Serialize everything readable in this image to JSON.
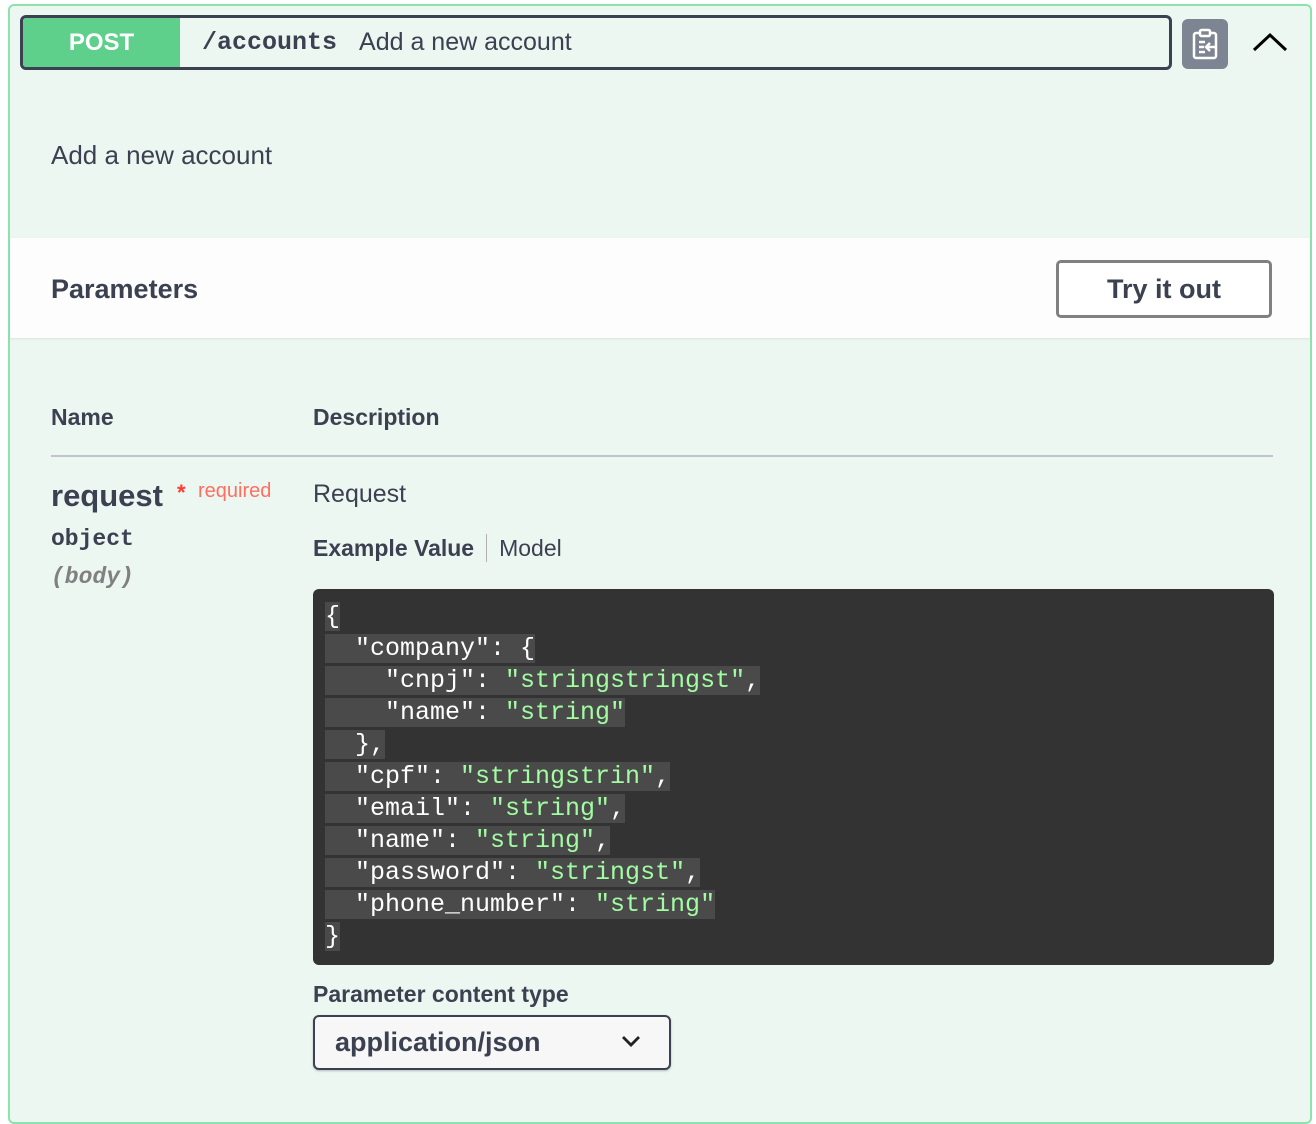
{
  "operation": {
    "method": "POST",
    "path": "/accounts",
    "summary": "Add a new account",
    "description": "Add a new account"
  },
  "parameters_section": {
    "title": "Parameters",
    "try_button": "Try it out",
    "columns": {
      "name": "Name",
      "description": "Description"
    }
  },
  "parameter": {
    "name": "request",
    "required_star": "*",
    "required_label": "required",
    "type": "object",
    "in": "(body)",
    "description": "Request",
    "tabs": {
      "example": "Example Value",
      "model": "Model"
    }
  },
  "example_lines": [
    [
      {
        "t": "{",
        "c": "p"
      }
    ],
    [
      {
        "t": "  \"company\": {",
        "c": "p"
      }
    ],
    [
      {
        "t": "    \"cnpj\": ",
        "c": "p"
      },
      {
        "t": "\"stringstringst\"",
        "c": "s"
      },
      {
        "t": ",",
        "c": "p"
      }
    ],
    [
      {
        "t": "    \"name\": ",
        "c": "p"
      },
      {
        "t": "\"string\"",
        "c": "s"
      }
    ],
    [
      {
        "t": "  },",
        "c": "p"
      }
    ],
    [
      {
        "t": "  \"cpf\": ",
        "c": "p"
      },
      {
        "t": "\"stringstrin\"",
        "c": "s"
      },
      {
        "t": ",",
        "c": "p"
      }
    ],
    [
      {
        "t": "  \"email\": ",
        "c": "p"
      },
      {
        "t": "\"string\"",
        "c": "s"
      },
      {
        "t": ",",
        "c": "p"
      }
    ],
    [
      {
        "t": "  \"name\": ",
        "c": "p"
      },
      {
        "t": "\"string\"",
        "c": "s"
      },
      {
        "t": ",",
        "c": "p"
      }
    ],
    [
      {
        "t": "  \"password\": ",
        "c": "p"
      },
      {
        "t": "\"stringst\"",
        "c": "s"
      },
      {
        "t": ",",
        "c": "p"
      }
    ],
    [
      {
        "t": "  \"phone_number\": ",
        "c": "p"
      },
      {
        "t": "\"string\"",
        "c": "s"
      }
    ],
    [
      {
        "t": "}",
        "c": "p"
      }
    ]
  ],
  "content_type": {
    "label": "Parameter content type",
    "selected": "application/json"
  },
  "icons": {
    "copy": "clipboard-icon",
    "collapse": "chevron-up-icon",
    "dropdown": "chevron-down-icon"
  },
  "colors": {
    "method_bg": "#5fcf8c",
    "block_bg": "#edf7f1",
    "block_border": "#8ee2ad",
    "string": "#a2fca2"
  }
}
